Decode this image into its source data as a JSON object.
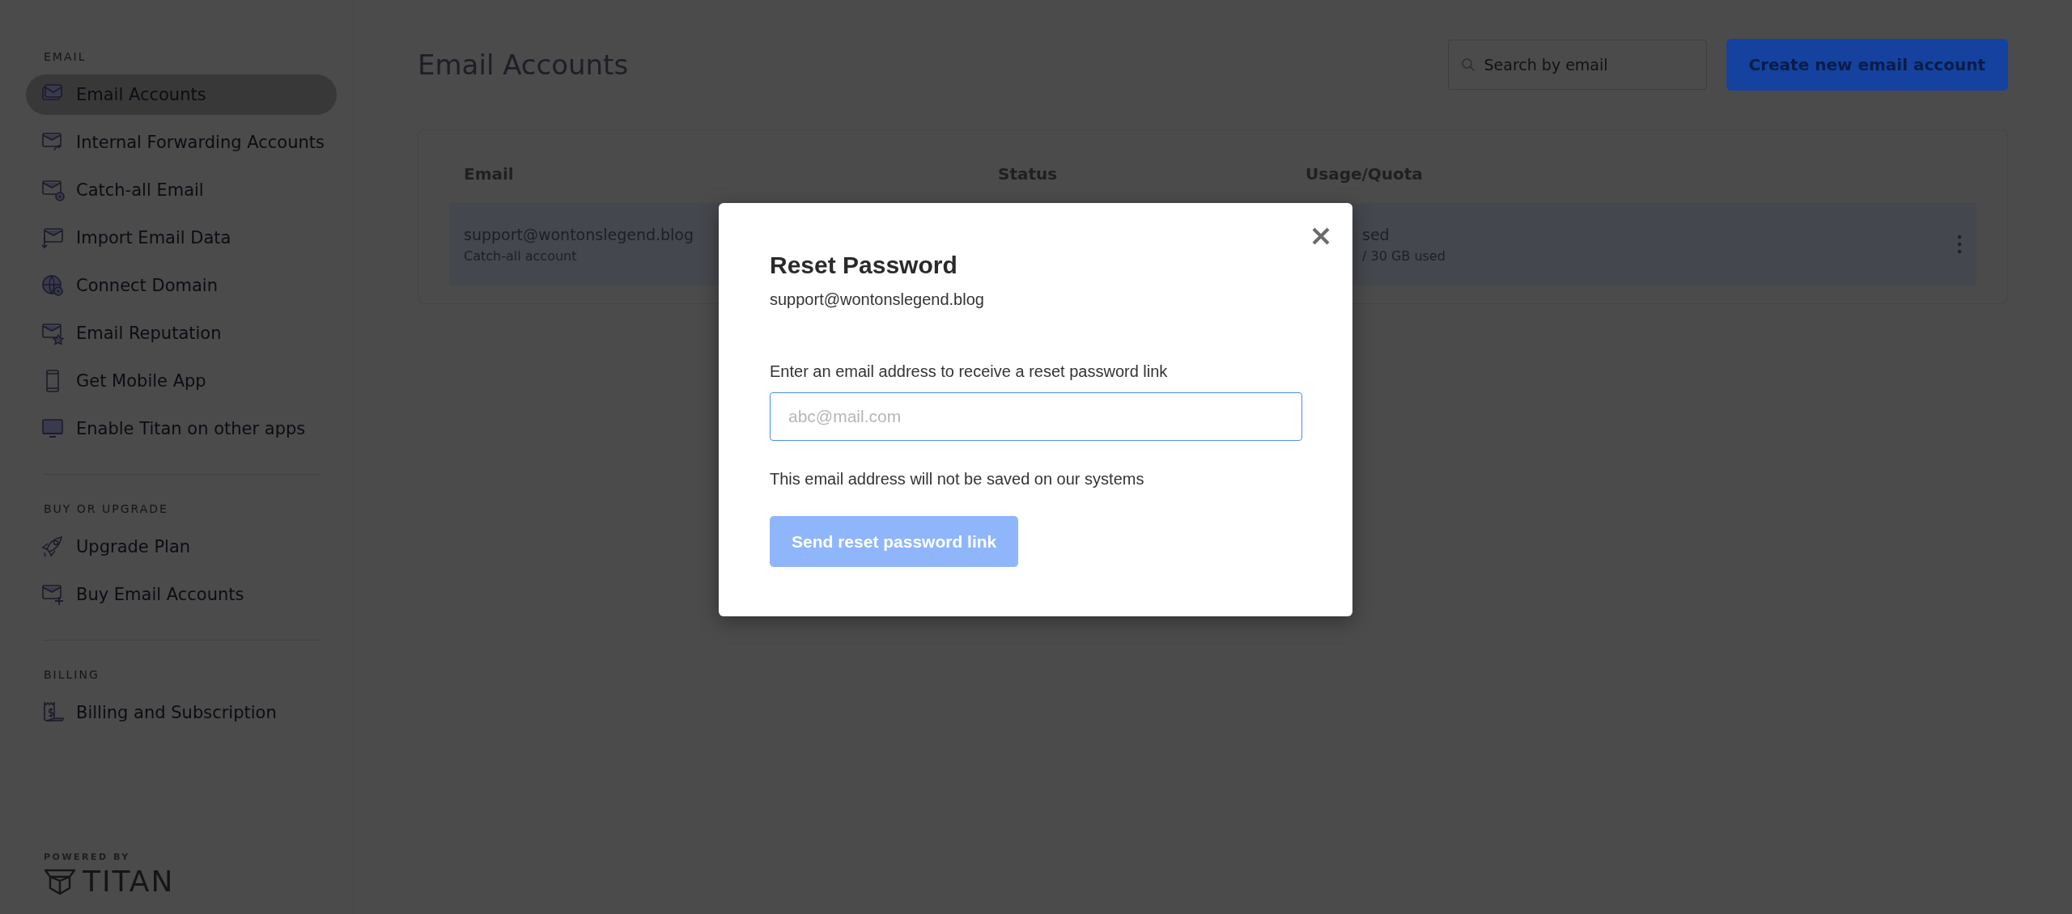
{
  "sidebar": {
    "sections": [
      {
        "label": "EMAIL",
        "items": [
          {
            "label": "Email Accounts",
            "selected": true
          },
          {
            "label": "Internal Forwarding Accounts",
            "selected": false
          },
          {
            "label": "Catch-all Email",
            "selected": false
          },
          {
            "label": "Import Email Data",
            "selected": false
          },
          {
            "label": "Connect Domain",
            "selected": false
          },
          {
            "label": "Email Reputation",
            "selected": false
          },
          {
            "label": "Get Mobile App",
            "selected": false
          },
          {
            "label": "Enable Titan on other apps",
            "selected": false
          }
        ]
      },
      {
        "label": "BUY OR UPGRADE",
        "items": [
          {
            "label": "Upgrade Plan",
            "selected": false
          },
          {
            "label": "Buy Email Accounts",
            "selected": false
          }
        ]
      },
      {
        "label": "BILLING",
        "items": [
          {
            "label": "Billing and Subscription",
            "selected": false
          }
        ]
      }
    ],
    "footer": {
      "caption": "POWERED BY",
      "brand": "TITAN"
    }
  },
  "header": {
    "title": "Email Accounts",
    "search": {
      "placeholder": "Search by email"
    },
    "create_button": "Create new email account"
  },
  "table": {
    "columns": [
      "Email",
      "Status",
      "Usage/Quota"
    ],
    "rows": [
      {
        "email": "support@wontonslegend.blog",
        "note": "Catch-all account",
        "usage": "sed",
        "quota": "/ 30 GB used"
      }
    ]
  },
  "dialog": {
    "title": "Reset Password",
    "account": "support@wontonslegend.blog",
    "prompt": "Enter an email address to receive a reset password link",
    "field": {
      "placeholder": "abc@mail.com"
    },
    "hint": "This email address will not be saved on our systems",
    "submit": {
      "label": "Send reset password link",
      "disabled": true
    }
  }
}
